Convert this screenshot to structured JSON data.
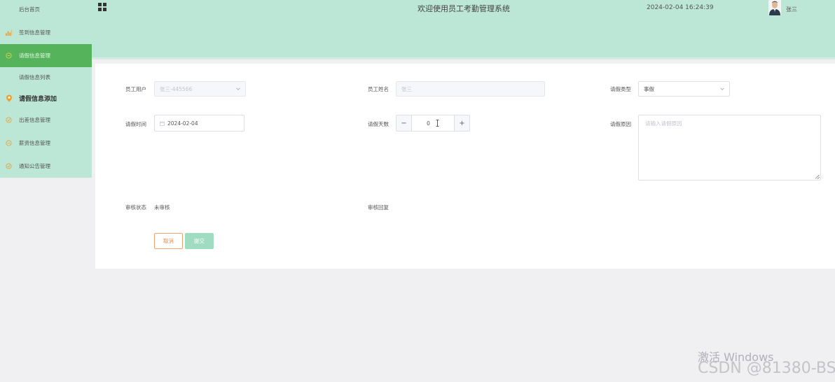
{
  "header": {
    "title": "欢迎使用员工考勤管理系统",
    "datetime": "2024-02-04 16:24:39",
    "username": "张三"
  },
  "sidebar": {
    "items": [
      {
        "label": "后台首页",
        "icon": ""
      },
      {
        "label": "签到信息管理",
        "icon": "bar-chart-icon"
      },
      {
        "label": "请假信息管理",
        "icon": "chat-icon"
      },
      {
        "label": "请假信息列表",
        "icon": ""
      },
      {
        "label": "请假信息添加",
        "icon": "location-pin-icon"
      },
      {
        "label": "出差信息管理",
        "icon": "check-circle-icon"
      },
      {
        "label": "薪资信息管理",
        "icon": "chat-icon"
      },
      {
        "label": "通知公告管理",
        "icon": "check-circle-icon"
      }
    ]
  },
  "form": {
    "employee_user_label": "员工用户",
    "employee_user_value": "张三-445566",
    "employee_name_label": "员工姓名",
    "employee_name_value": "张三",
    "leave_type_label": "请假类型",
    "leave_type_value": "事假",
    "leave_time_label": "请假时间",
    "leave_time_value": "2024-02-04",
    "leave_days_label": "请假天数",
    "leave_days_value": "0",
    "stepper_minus": "−",
    "stepper_plus": "+",
    "leave_reason_label": "请假原因",
    "leave_reason_placeholder": "请输入请假原因",
    "review_status_label": "审核状态",
    "review_status_value": "未审核",
    "review_reply_label": "审核回复",
    "cancel_label": "取消",
    "submit_label": "提交"
  },
  "watermark": {
    "line1": "激活 Windows",
    "line2": "CSDN @81380-BS"
  },
  "colors": {
    "menu_bg": "#bce6d6",
    "active_bg": "#55b35c",
    "accent_orange": "#f0a36b",
    "submit_bg": "#9fdcc0"
  }
}
